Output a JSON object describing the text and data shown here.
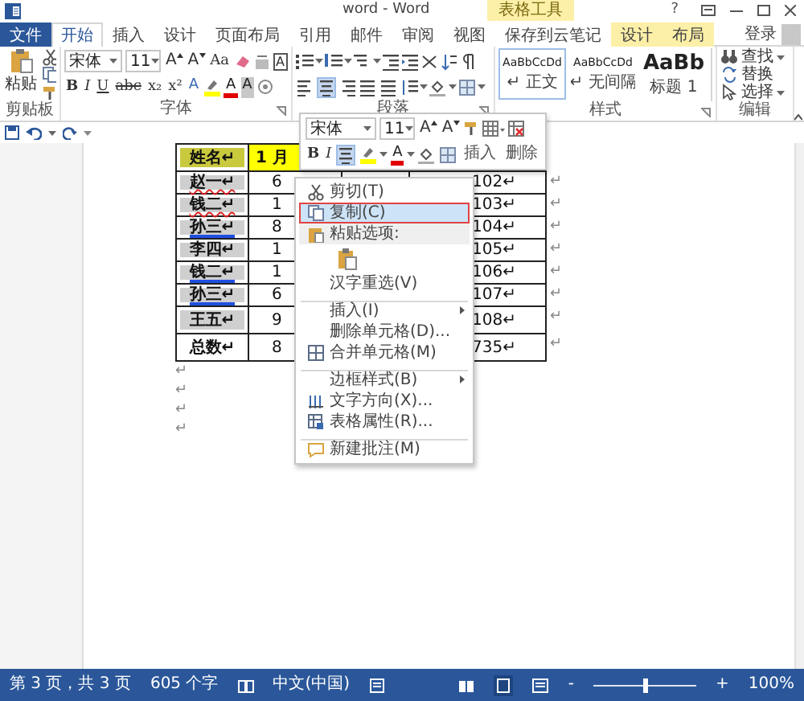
{
  "window": {
    "title": "word - Word",
    "contextual_group": "表格工具",
    "help": "?"
  },
  "tabs": [
    {
      "label": "文件",
      "kind": "file",
      "selected": false
    },
    {
      "label": "开始",
      "kind": "normal",
      "selected": true
    },
    {
      "label": "插入",
      "kind": "normal",
      "selected": false
    },
    {
      "label": "设计",
      "kind": "normal",
      "selected": false
    },
    {
      "label": "页面布局",
      "kind": "normal",
      "selected": false
    },
    {
      "label": "引用",
      "kind": "normal",
      "selected": false
    },
    {
      "label": "邮件",
      "kind": "normal",
      "selected": false
    },
    {
      "label": "审阅",
      "kind": "normal",
      "selected": false
    },
    {
      "label": "视图",
      "kind": "normal",
      "selected": false
    },
    {
      "label": "保存到云笔记",
      "kind": "normal",
      "selected": false
    },
    {
      "label": "设计",
      "kind": "contextual",
      "selected": false
    },
    {
      "label": "布局",
      "kind": "contextual",
      "selected": false
    }
  ],
  "account": "登录",
  "clipboard": {
    "paste": "粘贴",
    "label": "剪贴板"
  },
  "font": {
    "name": "宋体",
    "size": "11",
    "grow": "A",
    "shrink": "A",
    "case": "Aa",
    "border_char": "A",
    "formats": [
      "B",
      "I",
      "U",
      "abc",
      "x₂",
      "x²"
    ],
    "effects": "A",
    "color_letter": "A",
    "shading": "A",
    "label": "字体"
  },
  "paragraph": {
    "label": "段落",
    "alignments": [
      {
        "selected": false
      },
      {
        "selected": true
      },
      {
        "selected": false
      },
      {
        "selected": false
      },
      {
        "selected": false
      }
    ]
  },
  "styles": {
    "label": "样式",
    "items": [
      {
        "preview": "AaBbCcDd",
        "name": "↵ 正文",
        "kind": "normal",
        "selected": true
      },
      {
        "preview": "AaBbCcDd",
        "name": "↵ 无间隔",
        "kind": "normal",
        "selected": false
      },
      {
        "preview": "AaBb",
        "name": "标题 1",
        "kind": "heading",
        "selected": false
      }
    ]
  },
  "editing": {
    "label": "编辑",
    "items": [
      {
        "label": "查找",
        "dropdown": true
      },
      {
        "label": "替换",
        "dropdown": false
      },
      {
        "label": "选择",
        "dropdown": true
      }
    ]
  },
  "table": {
    "header": [
      {
        "text": "姓名↵",
        "shaded": true
      },
      {
        "text": "1 月",
        "shaded": false
      }
    ],
    "rows": [
      {
        "name": "赵一↵",
        "shaded": true,
        "spelling_mark": true,
        "grammar_mark": false,
        "col2": "6",
        "col4": "102↵",
        "end": "↵"
      },
      {
        "name": "钱二↵",
        "shaded": true,
        "spelling_mark": true,
        "grammar_mark": false,
        "col2": "1",
        "col4": "103↵",
        "end": "↵"
      },
      {
        "name": "孙三↵",
        "shaded": true,
        "spelling_mark": false,
        "grammar_mark": true,
        "col2": "8",
        "col4": "104↵",
        "end": "↵"
      },
      {
        "name": "李四↵",
        "shaded": true,
        "spelling_mark": false,
        "grammar_mark": false,
        "col2": "1",
        "col4": "105↵",
        "end": "↵"
      },
      {
        "name": "钱二↵",
        "shaded": true,
        "spelling_mark": false,
        "grammar_mark": true,
        "col2": "1",
        "col4": "106↵",
        "end": "↵"
      },
      {
        "name": "孙三↵",
        "shaded": true,
        "spelling_mark": false,
        "grammar_mark": true,
        "col2": "6",
        "col4": "107↵",
        "end": "↵"
      },
      {
        "name": "王五↵",
        "shaded": true,
        "spelling_mark": false,
        "grammar_mark": false,
        "col2": "9",
        "col4": "108↵",
        "end": "↵"
      },
      {
        "name": "总数↵",
        "shaded": false,
        "spelling_mark": false,
        "grammar_mark": false,
        "col2": "8",
        "col4": "735↵",
        "end": "↵"
      }
    ]
  },
  "paragraph_marks": [
    "↵",
    "↵",
    "↵",
    "↵"
  ],
  "mini_toolbar": {
    "font": "宋体",
    "size": "11",
    "grow": "A",
    "shrink": "A",
    "bold": "B",
    "italic": "I",
    "color_letter": "A",
    "insert": "插入",
    "delete": "删除",
    "center_selected": true
  },
  "context_menu": [
    {
      "kind": "item",
      "label": "剪切(T)",
      "selected": false,
      "submenu": false,
      "separator_before": false
    },
    {
      "kind": "item",
      "label": "复制(C)",
      "selected": true,
      "submenu": false,
      "separator_before": false
    },
    {
      "kind": "header",
      "label": "粘贴选项:",
      "selected": false,
      "submenu": false,
      "separator_before": false
    },
    {
      "kind": "paste"
    },
    {
      "kind": "item",
      "label": "汉字重选(V)",
      "selected": false,
      "submenu": false,
      "separator_before": false
    },
    {
      "kind": "item",
      "label": "插入(I)",
      "selected": false,
      "submenu": true,
      "separator_before": true
    },
    {
      "kind": "item",
      "label": "删除单元格(D)...",
      "selected": false,
      "submenu": false,
      "separator_before": false
    },
    {
      "kind": "item",
      "label": "合并单元格(M)",
      "selected": false,
      "submenu": false,
      "separator_before": false
    },
    {
      "kind": "item",
      "label": "边框样式(B)",
      "selected": false,
      "submenu": true,
      "separator_before": true
    },
    {
      "kind": "item",
      "label": "文字方向(X)...",
      "selected": false,
      "submenu": false,
      "separator_before": false
    },
    {
      "kind": "item",
      "label": "表格属性(R)...",
      "selected": false,
      "submenu": false,
      "separator_before": false
    },
    {
      "kind": "item",
      "label": "新建批注(M)",
      "selected": false,
      "submenu": false,
      "separator_before": true
    }
  ],
  "status": [
    {
      "kind": "text",
      "text": "第 3 页，共 3 页"
    },
    {
      "kind": "text",
      "text": "605 个字"
    },
    {
      "kind": "proofing"
    },
    {
      "kind": "text",
      "text": "中文(中国)"
    },
    {
      "kind": "macro"
    }
  ],
  "zoom": {
    "level": 0.5,
    "label": "100%",
    "minus": "-",
    "plus": "+"
  }
}
